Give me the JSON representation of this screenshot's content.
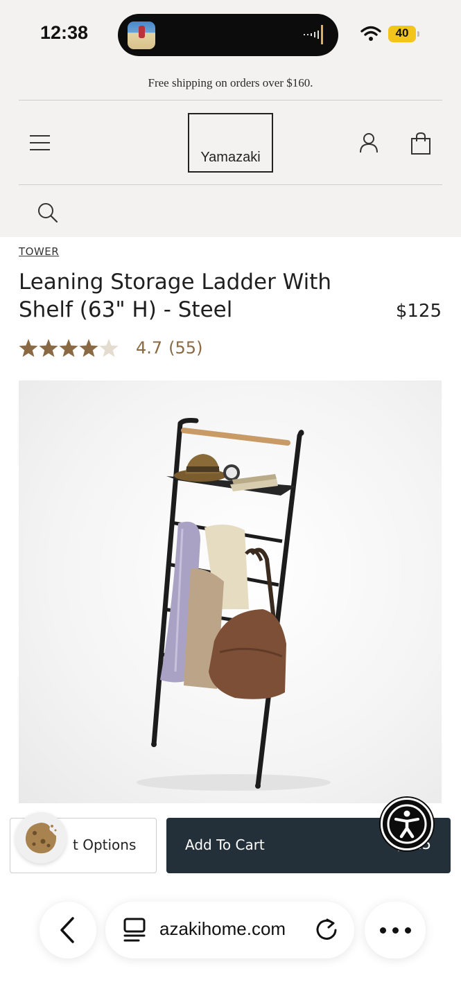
{
  "status_bar": {
    "time": "12:38",
    "battery": "40"
  },
  "header": {
    "promo": "Free shipping on orders over $160.",
    "logo": "Yamazaki",
    "icons": [
      "menu-icon",
      "account-icon",
      "shopping-bag-icon",
      "search-icon"
    ]
  },
  "product": {
    "vendor": "TOWER",
    "title": "Leaning Storage Ladder With Shelf (63\" H) - Steel",
    "price": "$125",
    "rating": "4.7",
    "review_count": "(55)",
    "stars_value": 4.7,
    "stars_max": 5,
    "star_color": "#8a6a44"
  },
  "actions": {
    "options_label": "t Options",
    "add_to_cart_label": "Add To Cart",
    "add_to_cart_price": "$125",
    "cart_button_color": "#233039"
  },
  "browser": {
    "url": "azakihome.com"
  }
}
